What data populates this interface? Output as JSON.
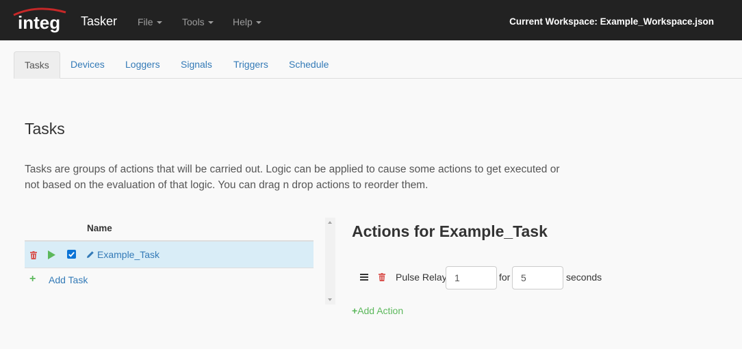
{
  "navbar": {
    "logo_text": "integ",
    "brand": "Tasker",
    "menus": [
      {
        "label": "File"
      },
      {
        "label": "Tools"
      },
      {
        "label": "Help"
      }
    ],
    "workspace": "Current Workspace: Example_Workspace.json"
  },
  "tabs": [
    {
      "label": "Tasks",
      "active": true
    },
    {
      "label": "Devices"
    },
    {
      "label": "Loggers"
    },
    {
      "label": "Signals"
    },
    {
      "label": "Triggers"
    },
    {
      "label": "Schedule"
    }
  ],
  "page": {
    "title": "Tasks",
    "description": "Tasks are groups of actions that will be carried out. Logic can be applied to cause some actions to get executed or not based on the evaluation of that logic. You can drag n drop actions to reorder them."
  },
  "task_table": {
    "header_name": "Name",
    "rows": [
      {
        "name": "Example_Task",
        "enabled": true
      }
    ],
    "add_label": "Add Task"
  },
  "actions": {
    "title": "Actions for Example_Task",
    "items": [
      {
        "label": "Pulse Relay",
        "relay": "1",
        "for_label": "for",
        "duration": "5",
        "unit_label": "seconds"
      }
    ],
    "add_label": "Add Action"
  },
  "colors": {
    "navbar_bg": "#222222",
    "link": "#337ab7",
    "delete": "#d9534f",
    "play": "#5cb85c",
    "selected_row": "#d9edf7"
  }
}
